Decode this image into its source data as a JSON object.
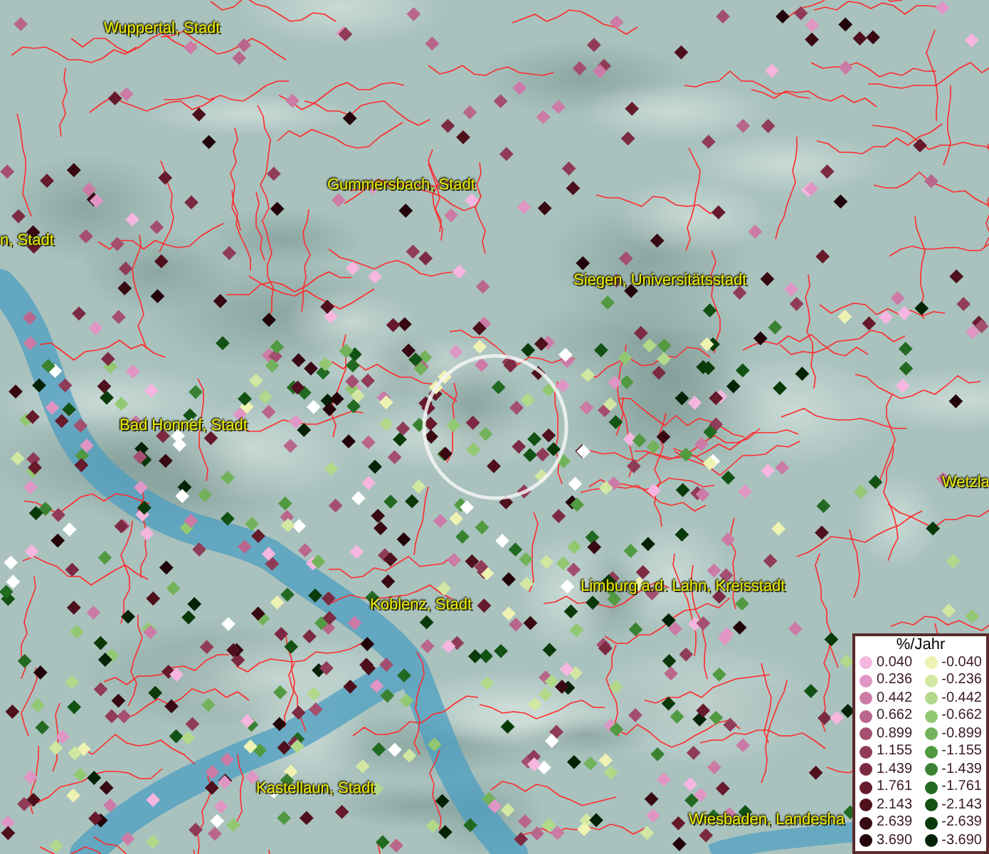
{
  "map": {
    "place_labels": [
      {
        "text": "Wuppertal, Stadt"
      },
      {
        "text": "Gummersbach, Stadt"
      },
      {
        "text": "n, Stadt"
      },
      {
        "text": "Siegen, Universitätsstadt"
      },
      {
        "text": "Bad Honnef, Stadt"
      },
      {
        "text": "Wetzla"
      },
      {
        "text": "Limburg a.d. Lahn, Kreisstadt"
      },
      {
        "text": "Koblenz, Stadt"
      },
      {
        "text": "Kastellaun, Stadt"
      },
      {
        "text": "Wiesbaden, Landesha"
      }
    ]
  },
  "legend": {
    "title": "%/Jahr",
    "columns": [
      {
        "entries": [
          {
            "value": "0.040",
            "color": "#f6b6e0"
          },
          {
            "value": "0.236",
            "color": "#e096c4"
          },
          {
            "value": "0.442",
            "color": "#cc7aa6"
          },
          {
            "value": "0.662",
            "color": "#b9668c"
          },
          {
            "value": "0.899",
            "color": "#a44f70"
          },
          {
            "value": "1.155",
            "color": "#903c58"
          },
          {
            "value": "1.439",
            "color": "#7c2a42"
          },
          {
            "value": "1.761",
            "color": "#661a2c"
          },
          {
            "value": "2.143",
            "color": "#4e101c"
          },
          {
            "value": "2.639",
            "color": "#380912"
          },
          {
            "value": "3.690",
            "color": "#22040a"
          }
        ]
      },
      {
        "entries": [
          {
            "value": "-0.040",
            "color": "#eef2b2"
          },
          {
            "value": "-0.236",
            "color": "#d2e8a2"
          },
          {
            "value": "-0.442",
            "color": "#b2d98a"
          },
          {
            "value": "-0.662",
            "color": "#92c872"
          },
          {
            "value": "-0.899",
            "color": "#72b25a"
          },
          {
            "value": "-1.155",
            "color": "#529a42"
          },
          {
            "value": "-1.439",
            "color": "#3a8232"
          },
          {
            "value": "-1.761",
            "color": "#226a22"
          },
          {
            "value": "-2.143",
            "color": "#125214"
          },
          {
            "value": "-2.639",
            "color": "#0a3a0a"
          },
          {
            "value": "-3.690",
            "color": "#042206"
          }
        ]
      }
    ]
  }
}
